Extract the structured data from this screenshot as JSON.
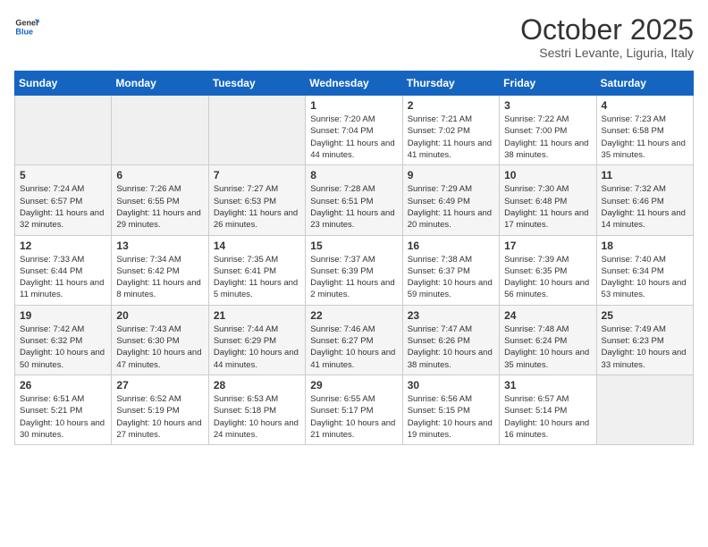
{
  "header": {
    "logo_general": "General",
    "logo_blue": "Blue",
    "month_title": "October 2025",
    "location": "Sestri Levante, Liguria, Italy"
  },
  "weekdays": [
    "Sunday",
    "Monday",
    "Tuesday",
    "Wednesday",
    "Thursday",
    "Friday",
    "Saturday"
  ],
  "weeks": [
    [
      {
        "day": "",
        "sunrise": "",
        "sunset": "",
        "daylight": "",
        "empty": true
      },
      {
        "day": "",
        "sunrise": "",
        "sunset": "",
        "daylight": "",
        "empty": true
      },
      {
        "day": "",
        "sunrise": "",
        "sunset": "",
        "daylight": "",
        "empty": true
      },
      {
        "day": "1",
        "sunrise": "Sunrise: 7:20 AM",
        "sunset": "Sunset: 7:04 PM",
        "daylight": "Daylight: 11 hours and 44 minutes.",
        "empty": false
      },
      {
        "day": "2",
        "sunrise": "Sunrise: 7:21 AM",
        "sunset": "Sunset: 7:02 PM",
        "daylight": "Daylight: 11 hours and 41 minutes.",
        "empty": false
      },
      {
        "day": "3",
        "sunrise": "Sunrise: 7:22 AM",
        "sunset": "Sunset: 7:00 PM",
        "daylight": "Daylight: 11 hours and 38 minutes.",
        "empty": false
      },
      {
        "day": "4",
        "sunrise": "Sunrise: 7:23 AM",
        "sunset": "Sunset: 6:58 PM",
        "daylight": "Daylight: 11 hours and 35 minutes.",
        "empty": false
      }
    ],
    [
      {
        "day": "5",
        "sunrise": "Sunrise: 7:24 AM",
        "sunset": "Sunset: 6:57 PM",
        "daylight": "Daylight: 11 hours and 32 minutes.",
        "empty": false
      },
      {
        "day": "6",
        "sunrise": "Sunrise: 7:26 AM",
        "sunset": "Sunset: 6:55 PM",
        "daylight": "Daylight: 11 hours and 29 minutes.",
        "empty": false
      },
      {
        "day": "7",
        "sunrise": "Sunrise: 7:27 AM",
        "sunset": "Sunset: 6:53 PM",
        "daylight": "Daylight: 11 hours and 26 minutes.",
        "empty": false
      },
      {
        "day": "8",
        "sunrise": "Sunrise: 7:28 AM",
        "sunset": "Sunset: 6:51 PM",
        "daylight": "Daylight: 11 hours and 23 minutes.",
        "empty": false
      },
      {
        "day": "9",
        "sunrise": "Sunrise: 7:29 AM",
        "sunset": "Sunset: 6:49 PM",
        "daylight": "Daylight: 11 hours and 20 minutes.",
        "empty": false
      },
      {
        "day": "10",
        "sunrise": "Sunrise: 7:30 AM",
        "sunset": "Sunset: 6:48 PM",
        "daylight": "Daylight: 11 hours and 17 minutes.",
        "empty": false
      },
      {
        "day": "11",
        "sunrise": "Sunrise: 7:32 AM",
        "sunset": "Sunset: 6:46 PM",
        "daylight": "Daylight: 11 hours and 14 minutes.",
        "empty": false
      }
    ],
    [
      {
        "day": "12",
        "sunrise": "Sunrise: 7:33 AM",
        "sunset": "Sunset: 6:44 PM",
        "daylight": "Daylight: 11 hours and 11 minutes.",
        "empty": false
      },
      {
        "day": "13",
        "sunrise": "Sunrise: 7:34 AM",
        "sunset": "Sunset: 6:42 PM",
        "daylight": "Daylight: 11 hours and 8 minutes.",
        "empty": false
      },
      {
        "day": "14",
        "sunrise": "Sunrise: 7:35 AM",
        "sunset": "Sunset: 6:41 PM",
        "daylight": "Daylight: 11 hours and 5 minutes.",
        "empty": false
      },
      {
        "day": "15",
        "sunrise": "Sunrise: 7:37 AM",
        "sunset": "Sunset: 6:39 PM",
        "daylight": "Daylight: 11 hours and 2 minutes.",
        "empty": false
      },
      {
        "day": "16",
        "sunrise": "Sunrise: 7:38 AM",
        "sunset": "Sunset: 6:37 PM",
        "daylight": "Daylight: 10 hours and 59 minutes.",
        "empty": false
      },
      {
        "day": "17",
        "sunrise": "Sunrise: 7:39 AM",
        "sunset": "Sunset: 6:35 PM",
        "daylight": "Daylight: 10 hours and 56 minutes.",
        "empty": false
      },
      {
        "day": "18",
        "sunrise": "Sunrise: 7:40 AM",
        "sunset": "Sunset: 6:34 PM",
        "daylight": "Daylight: 10 hours and 53 minutes.",
        "empty": false
      }
    ],
    [
      {
        "day": "19",
        "sunrise": "Sunrise: 7:42 AM",
        "sunset": "Sunset: 6:32 PM",
        "daylight": "Daylight: 10 hours and 50 minutes.",
        "empty": false
      },
      {
        "day": "20",
        "sunrise": "Sunrise: 7:43 AM",
        "sunset": "Sunset: 6:30 PM",
        "daylight": "Daylight: 10 hours and 47 minutes.",
        "empty": false
      },
      {
        "day": "21",
        "sunrise": "Sunrise: 7:44 AM",
        "sunset": "Sunset: 6:29 PM",
        "daylight": "Daylight: 10 hours and 44 minutes.",
        "empty": false
      },
      {
        "day": "22",
        "sunrise": "Sunrise: 7:46 AM",
        "sunset": "Sunset: 6:27 PM",
        "daylight": "Daylight: 10 hours and 41 minutes.",
        "empty": false
      },
      {
        "day": "23",
        "sunrise": "Sunrise: 7:47 AM",
        "sunset": "Sunset: 6:26 PM",
        "daylight": "Daylight: 10 hours and 38 minutes.",
        "empty": false
      },
      {
        "day": "24",
        "sunrise": "Sunrise: 7:48 AM",
        "sunset": "Sunset: 6:24 PM",
        "daylight": "Daylight: 10 hours and 35 minutes.",
        "empty": false
      },
      {
        "day": "25",
        "sunrise": "Sunrise: 7:49 AM",
        "sunset": "Sunset: 6:23 PM",
        "daylight": "Daylight: 10 hours and 33 minutes.",
        "empty": false
      }
    ],
    [
      {
        "day": "26",
        "sunrise": "Sunrise: 6:51 AM",
        "sunset": "Sunset: 5:21 PM",
        "daylight": "Daylight: 10 hours and 30 minutes.",
        "empty": false
      },
      {
        "day": "27",
        "sunrise": "Sunrise: 6:52 AM",
        "sunset": "Sunset: 5:19 PM",
        "daylight": "Daylight: 10 hours and 27 minutes.",
        "empty": false
      },
      {
        "day": "28",
        "sunrise": "Sunrise: 6:53 AM",
        "sunset": "Sunset: 5:18 PM",
        "daylight": "Daylight: 10 hours and 24 minutes.",
        "empty": false
      },
      {
        "day": "29",
        "sunrise": "Sunrise: 6:55 AM",
        "sunset": "Sunset: 5:17 PM",
        "daylight": "Daylight: 10 hours and 21 minutes.",
        "empty": false
      },
      {
        "day": "30",
        "sunrise": "Sunrise: 6:56 AM",
        "sunset": "Sunset: 5:15 PM",
        "daylight": "Daylight: 10 hours and 19 minutes.",
        "empty": false
      },
      {
        "day": "31",
        "sunrise": "Sunrise: 6:57 AM",
        "sunset": "Sunset: 5:14 PM",
        "daylight": "Daylight: 10 hours and 16 minutes.",
        "empty": false
      },
      {
        "day": "",
        "sunrise": "",
        "sunset": "",
        "daylight": "",
        "empty": true
      }
    ]
  ]
}
